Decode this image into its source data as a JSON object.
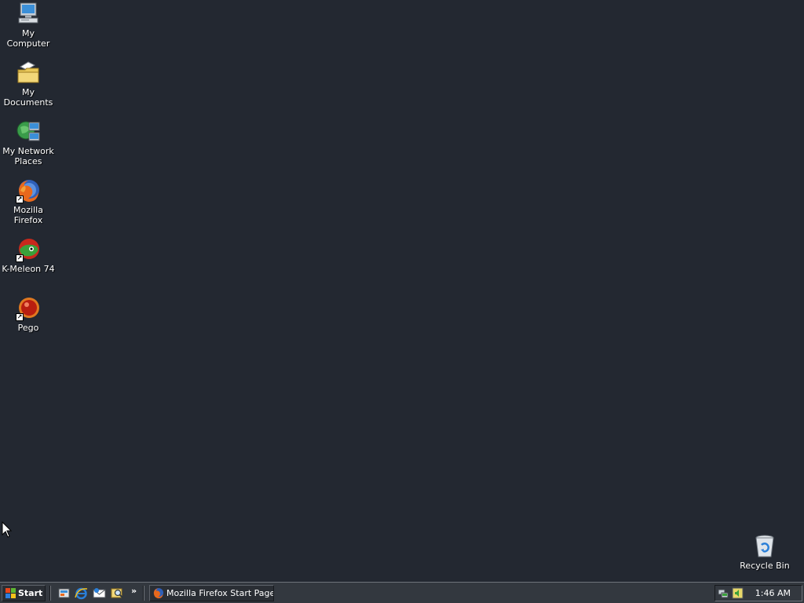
{
  "desktop": {
    "icons": [
      {
        "label": "My Computer",
        "icon": "my-computer-icon"
      },
      {
        "label": "My Documents",
        "icon": "my-documents-icon"
      },
      {
        "label": "My Network Places",
        "icon": "network-places-icon"
      },
      {
        "label": "Mozilla Firefox",
        "icon": "firefox-icon"
      },
      {
        "label": "K-Meleon 74",
        "icon": "k-meleon-icon"
      },
      {
        "label": "Pego",
        "icon": "pego-icon"
      }
    ],
    "recycle_bin": {
      "label": "Recycle Bin",
      "icon": "recycle-bin-icon"
    },
    "background_color": "#232831"
  },
  "taskbar": {
    "start_label": "Start",
    "quick_launch": [
      "show-desktop-icon",
      "internet-explorer-icon",
      "outlook-express-icon",
      "search-icon"
    ],
    "quick_launch_more": "»",
    "tasks": [
      {
        "label": "Mozilla Firefox Start Page...",
        "icon": "firefox-icon",
        "active": false
      }
    ],
    "tray_icons": [
      "network-icon",
      "volume-icon"
    ],
    "clock": "1:46 AM",
    "background_color": "#33383f"
  }
}
